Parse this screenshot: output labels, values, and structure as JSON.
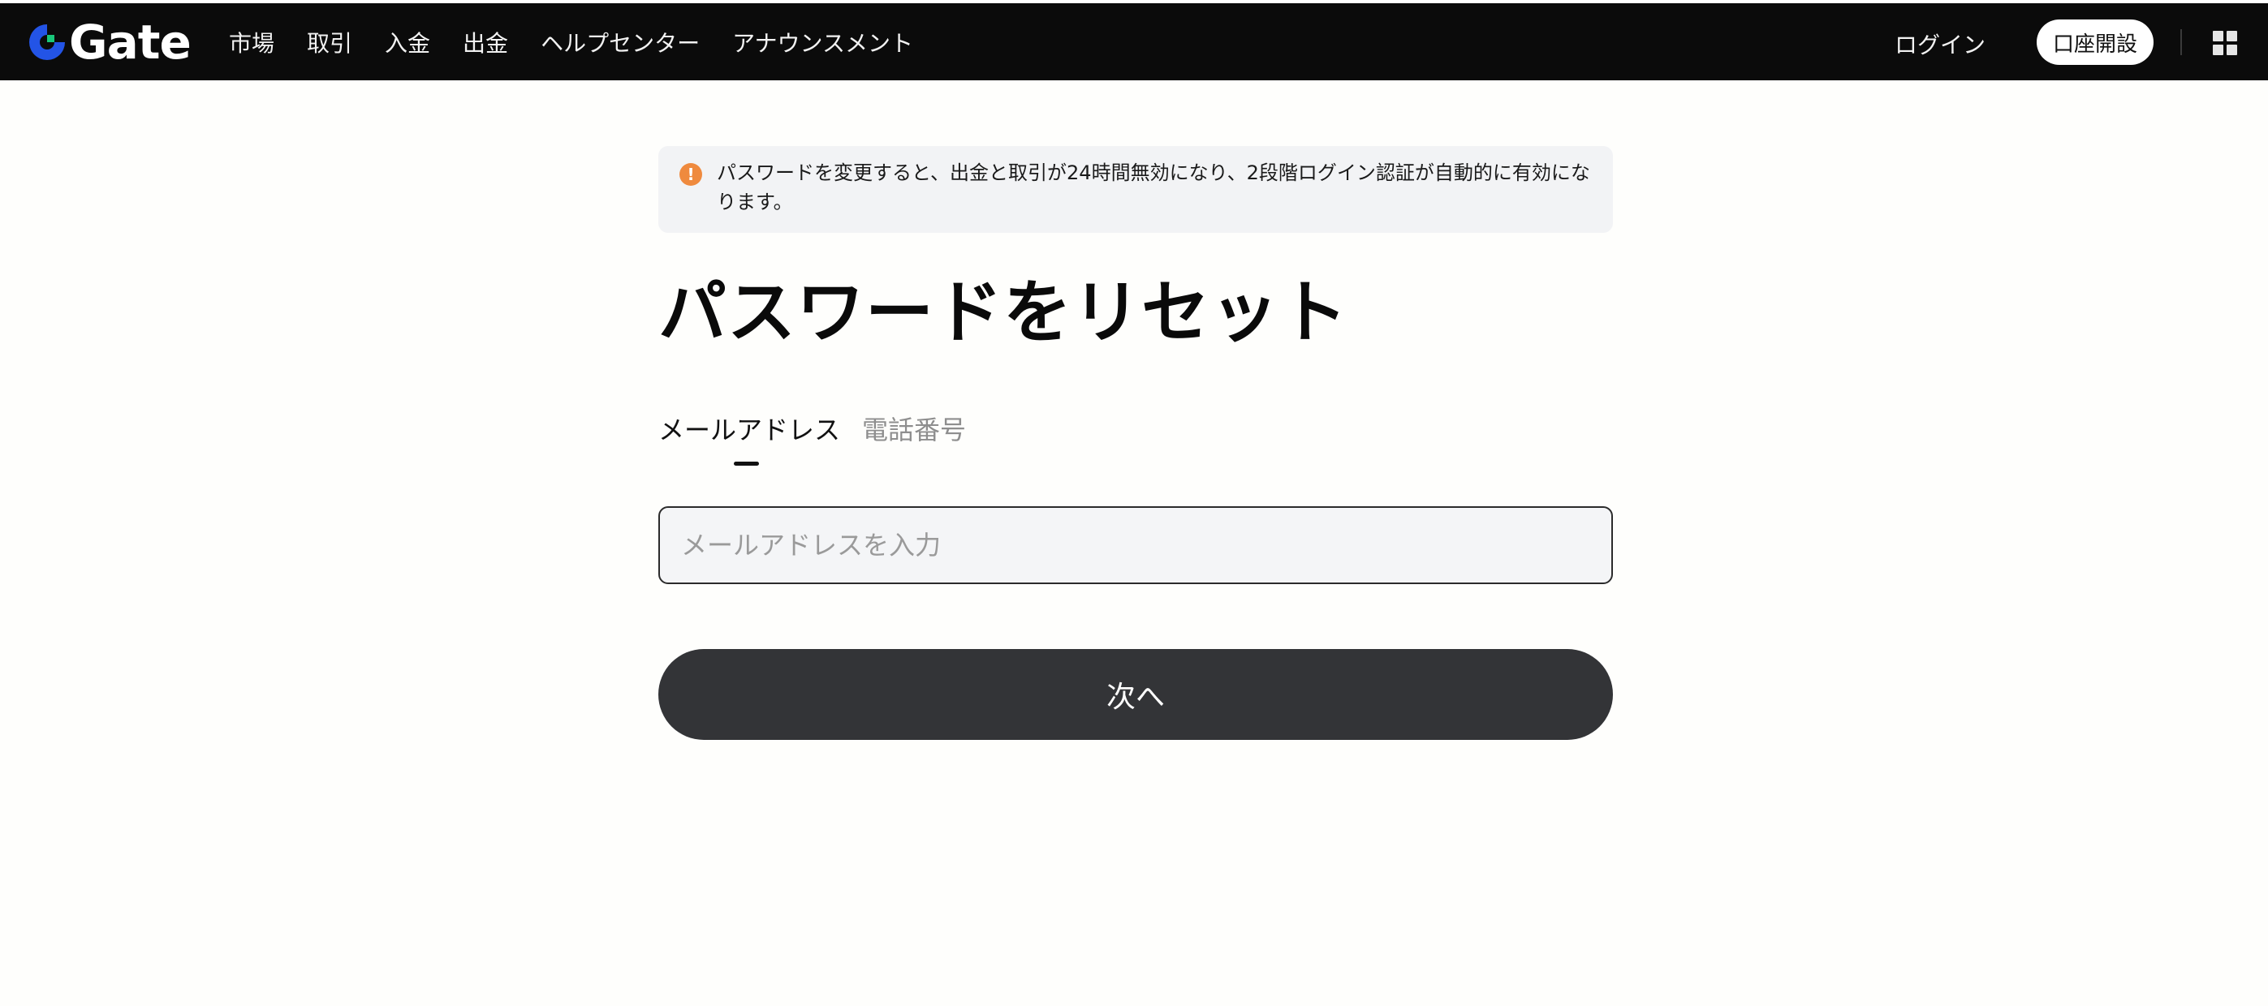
{
  "brand": {
    "logo_text": "Gate",
    "logo_colors": {
      "ring": "#2354e6",
      "accent": "#19c77a",
      "text": "#ffffff"
    }
  },
  "nav": {
    "links": [
      "市場",
      "取引",
      "入金",
      "出金",
      "ヘルプセンター",
      "アナウンスメント"
    ],
    "login_label": "ログイン",
    "signup_label": "口座開設",
    "apps_icon": "grid-icon"
  },
  "notice": {
    "icon": "warning-icon",
    "icon_color": "#ef8a3e",
    "text": "パスワードを変更すると、出金と取引が24時間無効になり、2段階ログイン認証が自動的に有効になります。"
  },
  "page": {
    "title": "パスワードをリセット",
    "tabs": [
      {
        "label": "メールアドレス",
        "active": true
      },
      {
        "label": "電話番号",
        "active": false
      }
    ],
    "email_placeholder": "メールアドレスを入力",
    "email_value": "",
    "next_label": "次へ"
  }
}
